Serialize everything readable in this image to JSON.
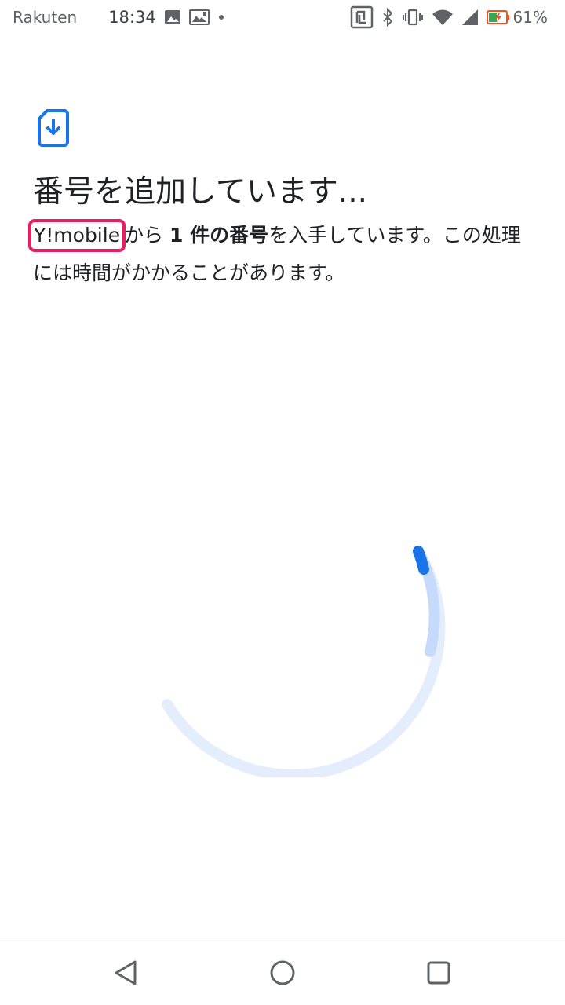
{
  "status_bar": {
    "carrier": "Rakuten",
    "time": "18:34",
    "battery_percent": "61%",
    "left_icons": [
      "image-icon",
      "gallery-icon",
      "dot-icon"
    ],
    "right_icons": [
      "nfc-icon",
      "bluetooth-icon",
      "vibrate-icon",
      "wifi-icon",
      "signal-icon",
      "battery-icon"
    ]
  },
  "main": {
    "icon": "sim-download-icon",
    "title": "番号を追加しています...",
    "description": {
      "carrier": "Y!mobile",
      "part1": "から ",
      "bold": "1 件の番号",
      "part2": "を入手しています。この処理には時間がかかることがあります。"
    },
    "progress": "indeterminate"
  },
  "nav_bar": {
    "buttons": [
      "back-icon",
      "home-icon",
      "recents-icon"
    ]
  },
  "colors": {
    "accent": "#1a73e8",
    "spinner_track": "#e3edfc",
    "highlight": "#e91e63",
    "text": "#202124",
    "status_text": "#5f6368"
  }
}
